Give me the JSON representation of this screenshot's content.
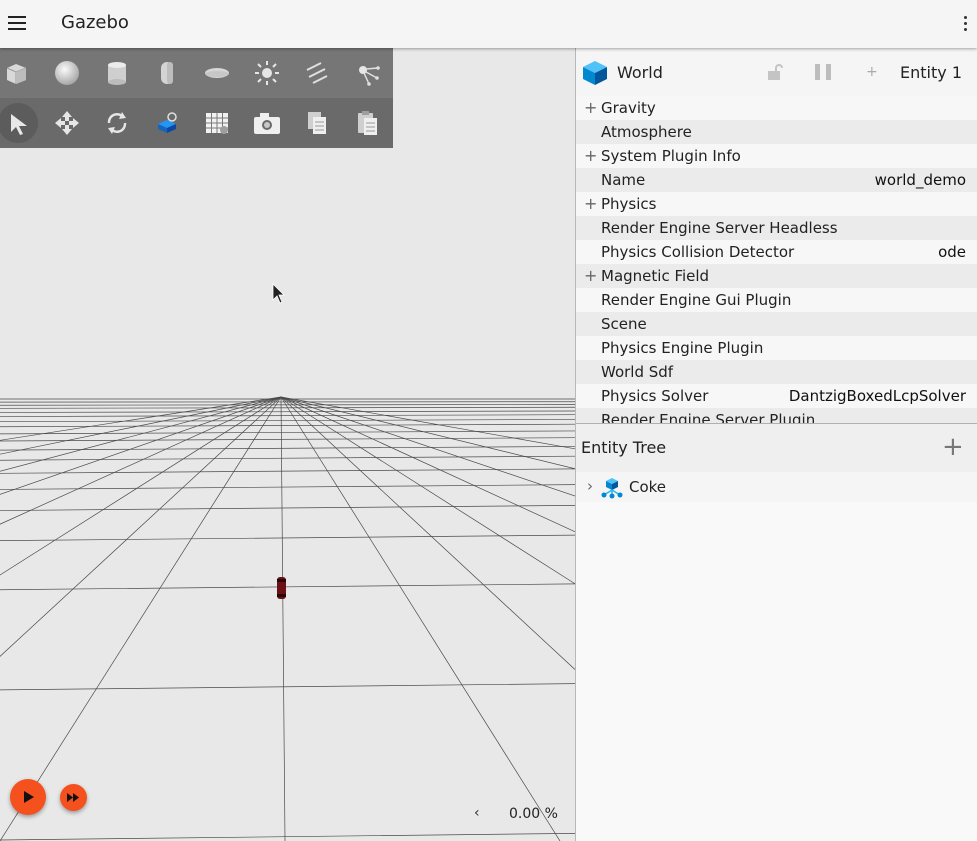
{
  "header": {
    "title": "Gazebo"
  },
  "toolbar": {
    "shapes": [
      "box",
      "sphere",
      "cylinder",
      "capsule",
      "ellipsoid",
      "point-light",
      "directional-light",
      "spot-light"
    ],
    "transform_tools": [
      "select",
      "translate",
      "rotate",
      "spawn",
      "grid-config",
      "screenshot",
      "copy",
      "paste"
    ],
    "selected_tool": "select"
  },
  "playback": {
    "rtf": "0.00 %",
    "collapse_symbol": "‹",
    "accent": "#f4511e"
  },
  "component_inspector": {
    "title": "World",
    "entity": "Entity 1",
    "add_symbol": "+",
    "properties": [
      {
        "label": "Gravity",
        "value": "",
        "expandable": true
      },
      {
        "label": "Atmosphere",
        "value": "",
        "expandable": false
      },
      {
        "label": "System Plugin Info",
        "value": "",
        "expandable": true
      },
      {
        "label": "Name",
        "value": "world_demo",
        "expandable": false
      },
      {
        "label": "Physics",
        "value": "",
        "expandable": true
      },
      {
        "label": "Render Engine Server Headless",
        "value": "",
        "expandable": false
      },
      {
        "label": "Physics Collision Detector",
        "value": "ode",
        "expandable": false
      },
      {
        "label": "Magnetic Field",
        "value": "",
        "expandable": true
      },
      {
        "label": "Render Engine Gui Plugin",
        "value": "",
        "expandable": false
      },
      {
        "label": "Scene",
        "value": "",
        "expandable": false
      },
      {
        "label": "Physics Engine Plugin",
        "value": "",
        "expandable": false
      },
      {
        "label": "World Sdf",
        "value": "",
        "expandable": false
      },
      {
        "label": "Physics Solver",
        "value": "DantzigBoxedLcpSolver",
        "expandable": false
      },
      {
        "label": "Render Engine Server Plugin",
        "value": "",
        "expandable": false
      }
    ]
  },
  "entity_tree": {
    "title": "Entity Tree",
    "add_symbol": "+",
    "items": [
      {
        "label": "Coke",
        "icon": "model-icon",
        "chevron": "›"
      }
    ]
  }
}
